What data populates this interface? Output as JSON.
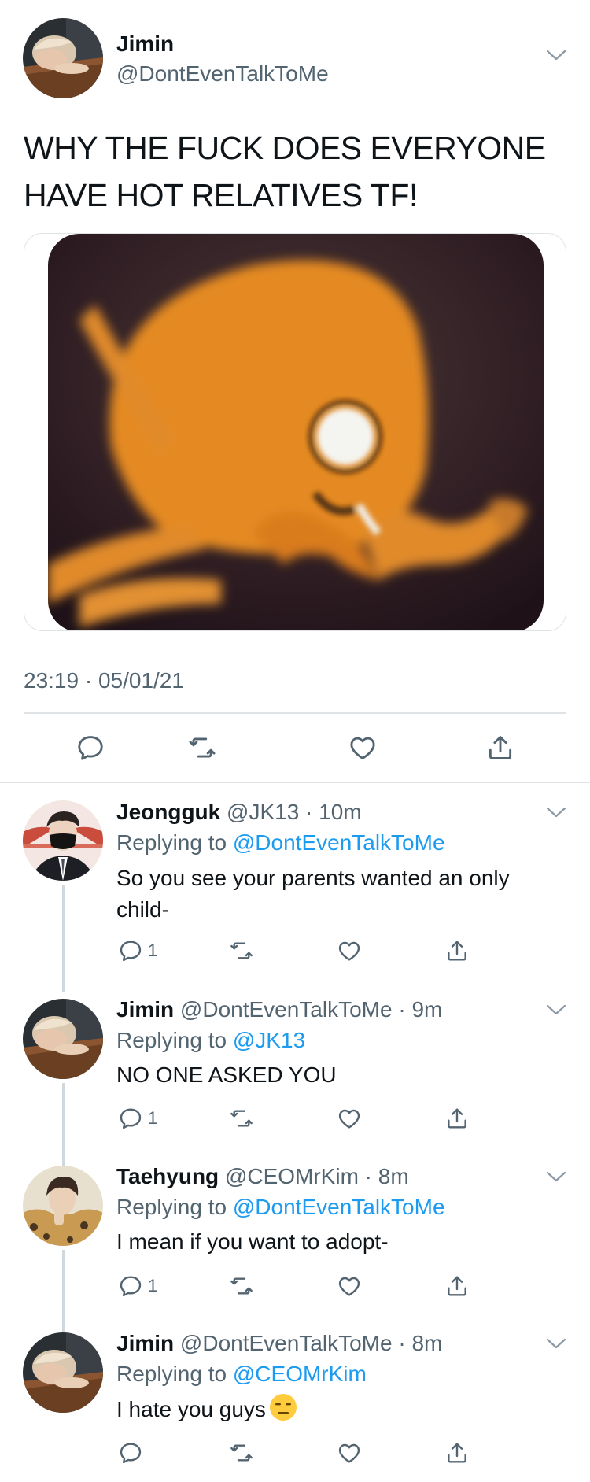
{
  "main_tweet": {
    "author_name": "Jimin",
    "author_handle": "@DontEvenTalkToMe",
    "text": "WHY THE FUCK DOES EVERYONE HAVE HOT RELATIVES TF!",
    "media_icon": "jake-the-dog-blurred-meme-image",
    "timestamp": "23:19 · 05/01/21",
    "actions": [
      "reply-icon",
      "retweet-icon",
      "like-icon",
      "share-icon"
    ]
  },
  "replies": [
    {
      "name": "Jeongguk",
      "meta": "@JK13 · 10m",
      "replying_prefix": "Replying to ",
      "replying_to": "@DontEvenTalkToMe",
      "text": "So you see your parents wanted an only child-",
      "reply_count": "1"
    },
    {
      "name": "Jimin",
      "meta": "@DontEvenTalkToMe · 9m",
      "replying_prefix": "Replying to ",
      "replying_to": "@JK13",
      "text": "NO ONE ASKED YOU",
      "reply_count": "1"
    },
    {
      "name": "Taehyung",
      "meta": "@CEOMrKim · 8m",
      "replying_prefix": "Replying to ",
      "replying_to": "@DontEvenTalkToMe",
      "text": "I mean if you want to adopt-",
      "reply_count": "1"
    },
    {
      "name": "Jimin",
      "meta": "@DontEvenTalkToMe · 8m",
      "replying_prefix": "Replying to ",
      "replying_to": "@CEOMrKim",
      "text": "I hate you guys",
      "emoji": "expressionless-face-emoji",
      "reply_count": ""
    }
  ],
  "colors": {
    "text": "#0f1419",
    "secondary": "#536471",
    "link": "#1d9bf0",
    "divider": "#dfe3e6",
    "thread_line": "#cfd9de"
  }
}
